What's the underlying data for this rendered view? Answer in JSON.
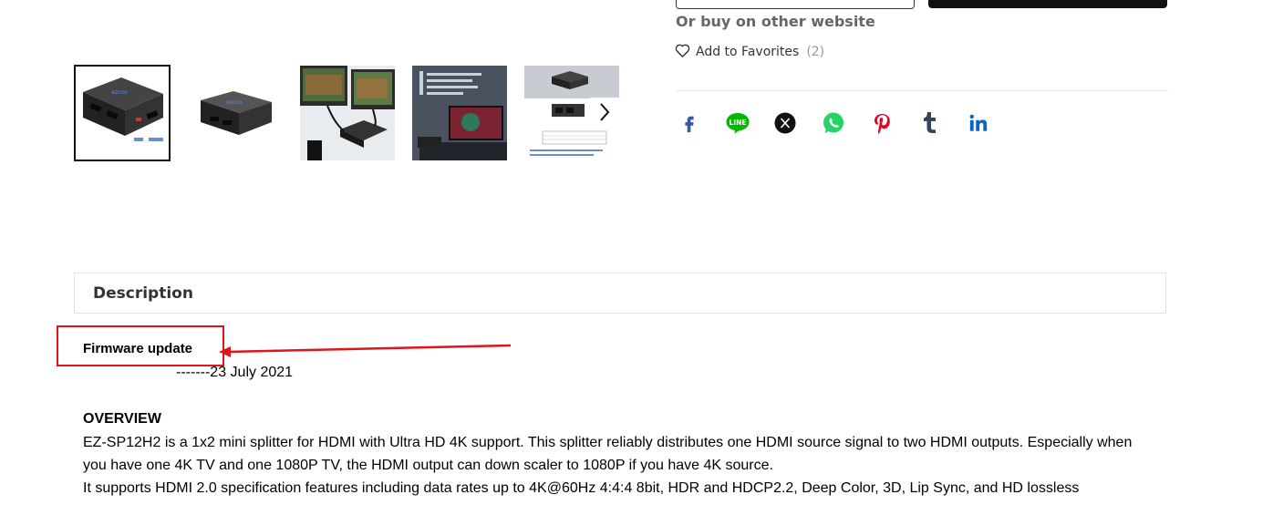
{
  "purchase": {
    "other_site_text": "Or buy on other website",
    "favorites_label": "Add to Favorites",
    "favorites_count": "(2)"
  },
  "share": {
    "items": [
      {
        "name": "facebook",
        "color": "#3b5998"
      },
      {
        "name": "line",
        "color": "#00b900"
      },
      {
        "name": "x",
        "color": "#111111"
      },
      {
        "name": "whatsapp",
        "color": "#25d366"
      },
      {
        "name": "pinterest",
        "color": "#e60023"
      },
      {
        "name": "tumblr",
        "color": "#35465c"
      },
      {
        "name": "linkedin",
        "color": "#0a66c2"
      }
    ]
  },
  "gallery": {
    "thumbnails": [
      "product-front",
      "product-angle",
      "product-with-tvs",
      "product-scene",
      "product-spec-sheet"
    ],
    "selected_index": 0
  },
  "description": {
    "tab_label": "Description",
    "firmware_title": "Firmware update",
    "firmware_date": "-------23 July 2021",
    "overview_title": "OVERVIEW",
    "overview_lines": [
      "EZ-SP12H2 is a 1x2 mini splitter for HDMI with Ultra HD 4K support. This splitter reliably distributes one HDMI source signal to two HDMI outputs. Especially when",
      "you have one 4K TV and one 1080P TV, the HDMI output can down scaler to 1080P if you have 4K source.",
      "It supports HDMI 2.0 specification features including data rates up to 4K@60Hz 4:4:4 8bit, HDR and HDCP2.2, Deep Color, 3D, Lip Sync, and HD lossless"
    ]
  },
  "annotation": {
    "color": "#e0141e"
  }
}
